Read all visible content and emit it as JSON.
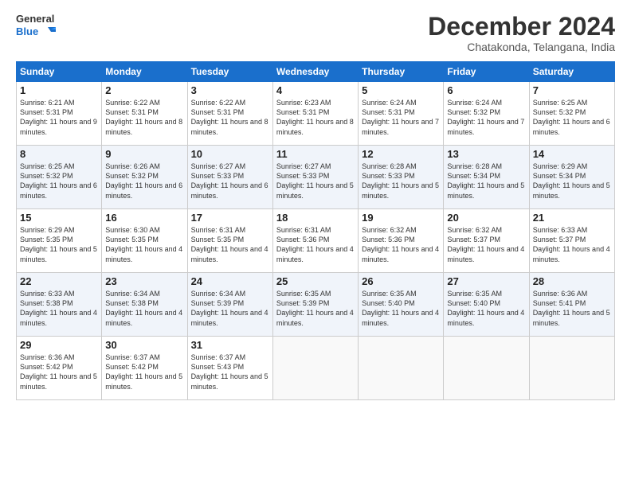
{
  "logo": {
    "line1": "General",
    "line2": "Blue"
  },
  "title": "December 2024",
  "location": "Chatakonda, Telangana, India",
  "days_of_week": [
    "Sunday",
    "Monday",
    "Tuesday",
    "Wednesday",
    "Thursday",
    "Friday",
    "Saturday"
  ],
  "weeks": [
    [
      {
        "day": "1",
        "sunrise": "6:21 AM",
        "sunset": "5:31 PM",
        "daylight": "11 hours and 9 minutes."
      },
      {
        "day": "2",
        "sunrise": "6:22 AM",
        "sunset": "5:31 PM",
        "daylight": "11 hours and 8 minutes."
      },
      {
        "day": "3",
        "sunrise": "6:22 AM",
        "sunset": "5:31 PM",
        "daylight": "11 hours and 8 minutes."
      },
      {
        "day": "4",
        "sunrise": "6:23 AM",
        "sunset": "5:31 PM",
        "daylight": "11 hours and 8 minutes."
      },
      {
        "day": "5",
        "sunrise": "6:24 AM",
        "sunset": "5:31 PM",
        "daylight": "11 hours and 7 minutes."
      },
      {
        "day": "6",
        "sunrise": "6:24 AM",
        "sunset": "5:32 PM",
        "daylight": "11 hours and 7 minutes."
      },
      {
        "day": "7",
        "sunrise": "6:25 AM",
        "sunset": "5:32 PM",
        "daylight": "11 hours and 6 minutes."
      }
    ],
    [
      {
        "day": "8",
        "sunrise": "6:25 AM",
        "sunset": "5:32 PM",
        "daylight": "11 hours and 6 minutes."
      },
      {
        "day": "9",
        "sunrise": "6:26 AM",
        "sunset": "5:32 PM",
        "daylight": "11 hours and 6 minutes."
      },
      {
        "day": "10",
        "sunrise": "6:27 AM",
        "sunset": "5:33 PM",
        "daylight": "11 hours and 6 minutes."
      },
      {
        "day": "11",
        "sunrise": "6:27 AM",
        "sunset": "5:33 PM",
        "daylight": "11 hours and 5 minutes."
      },
      {
        "day": "12",
        "sunrise": "6:28 AM",
        "sunset": "5:33 PM",
        "daylight": "11 hours and 5 minutes."
      },
      {
        "day": "13",
        "sunrise": "6:28 AM",
        "sunset": "5:34 PM",
        "daylight": "11 hours and 5 minutes."
      },
      {
        "day": "14",
        "sunrise": "6:29 AM",
        "sunset": "5:34 PM",
        "daylight": "11 hours and 5 minutes."
      }
    ],
    [
      {
        "day": "15",
        "sunrise": "6:29 AM",
        "sunset": "5:35 PM",
        "daylight": "11 hours and 5 minutes."
      },
      {
        "day": "16",
        "sunrise": "6:30 AM",
        "sunset": "5:35 PM",
        "daylight": "11 hours and 4 minutes."
      },
      {
        "day": "17",
        "sunrise": "6:31 AM",
        "sunset": "5:35 PM",
        "daylight": "11 hours and 4 minutes."
      },
      {
        "day": "18",
        "sunrise": "6:31 AM",
        "sunset": "5:36 PM",
        "daylight": "11 hours and 4 minutes."
      },
      {
        "day": "19",
        "sunrise": "6:32 AM",
        "sunset": "5:36 PM",
        "daylight": "11 hours and 4 minutes."
      },
      {
        "day": "20",
        "sunrise": "6:32 AM",
        "sunset": "5:37 PM",
        "daylight": "11 hours and 4 minutes."
      },
      {
        "day": "21",
        "sunrise": "6:33 AM",
        "sunset": "5:37 PM",
        "daylight": "11 hours and 4 minutes."
      }
    ],
    [
      {
        "day": "22",
        "sunrise": "6:33 AM",
        "sunset": "5:38 PM",
        "daylight": "11 hours and 4 minutes."
      },
      {
        "day": "23",
        "sunrise": "6:34 AM",
        "sunset": "5:38 PM",
        "daylight": "11 hours and 4 minutes."
      },
      {
        "day": "24",
        "sunrise": "6:34 AM",
        "sunset": "5:39 PM",
        "daylight": "11 hours and 4 minutes."
      },
      {
        "day": "25",
        "sunrise": "6:35 AM",
        "sunset": "5:39 PM",
        "daylight": "11 hours and 4 minutes."
      },
      {
        "day": "26",
        "sunrise": "6:35 AM",
        "sunset": "5:40 PM",
        "daylight": "11 hours and 4 minutes."
      },
      {
        "day": "27",
        "sunrise": "6:35 AM",
        "sunset": "5:40 PM",
        "daylight": "11 hours and 4 minutes."
      },
      {
        "day": "28",
        "sunrise": "6:36 AM",
        "sunset": "5:41 PM",
        "daylight": "11 hours and 5 minutes."
      }
    ],
    [
      {
        "day": "29",
        "sunrise": "6:36 AM",
        "sunset": "5:42 PM",
        "daylight": "11 hours and 5 minutes."
      },
      {
        "day": "30",
        "sunrise": "6:37 AM",
        "sunset": "5:42 PM",
        "daylight": "11 hours and 5 minutes."
      },
      {
        "day": "31",
        "sunrise": "6:37 AM",
        "sunset": "5:43 PM",
        "daylight": "11 hours and 5 minutes."
      },
      null,
      null,
      null,
      null
    ]
  ]
}
